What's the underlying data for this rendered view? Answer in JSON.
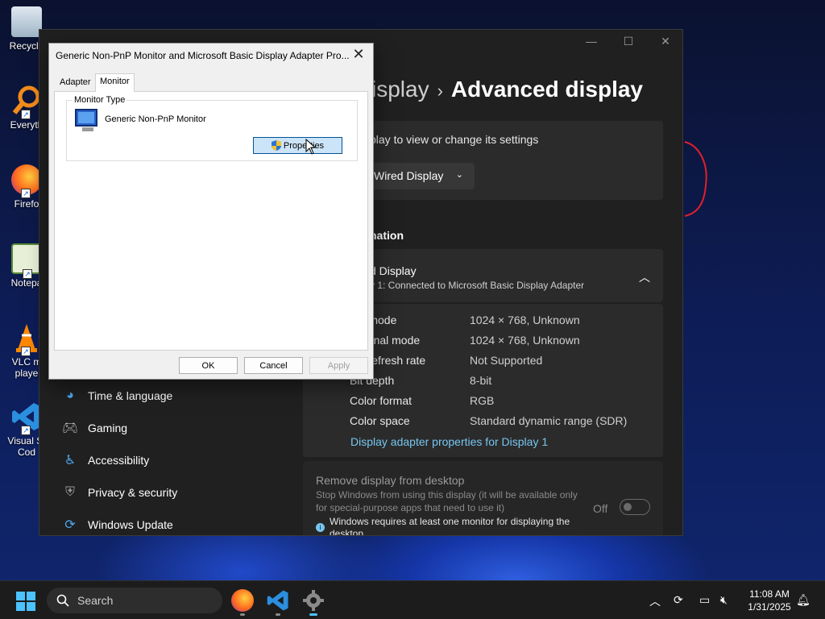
{
  "desktop": {
    "icons": [
      {
        "label": "Recycle",
        "icon": "recycle-bin-icon"
      },
      {
        "label": "Everyth",
        "icon": "everything-search-icon"
      },
      {
        "label": "Firefo",
        "icon": "firefox-icon"
      },
      {
        "label": "Notepa",
        "icon": "notepad-icon"
      },
      {
        "label": "VLC m playe",
        "icon": "vlc-icon"
      },
      {
        "label": "Visual St Cod",
        "icon": "vscode-icon"
      }
    ]
  },
  "settings": {
    "breadcrumb_prev": "isplay",
    "breadcrumb_current": "Advanced display",
    "select_text": "play to view or change its settings",
    "display_dropdown": "Wired Display",
    "section_heading": "nation",
    "info_title": "d Display",
    "info_subtitle": "y 1: Connected to Microsoft Basic Display Adapter",
    "rows": [
      {
        "label": "top mode",
        "value": "1024 × 768, Unknown"
      },
      {
        "label": "e signal mode",
        "value": "1024 × 768, Unknown"
      },
      {
        "label": "ble refresh rate",
        "value": "Not Supported"
      },
      {
        "label": "Bit depth",
        "value": "8-bit"
      },
      {
        "label": "Color format",
        "value": "RGB"
      },
      {
        "label": "Color space",
        "value": "Standard dynamic range (SDR)"
      }
    ],
    "link": "Display adapter properties for Display 1",
    "remove_title": "Remove display from desktop",
    "remove_desc": "Stop Windows from using this display (it will be available only for special-purpose apps that need to use it)",
    "toggle_label": "Off",
    "warning": "Windows requires at least one monitor for displaying the desktop",
    "nav": [
      {
        "label": "Time & language",
        "icon": "globe-clock-icon"
      },
      {
        "label": "Gaming",
        "icon": "gamepad-icon"
      },
      {
        "label": "Accessibility",
        "icon": "accessibility-icon"
      },
      {
        "label": "Privacy & security",
        "icon": "shield-icon"
      },
      {
        "label": "Windows Update",
        "icon": "update-icon"
      }
    ]
  },
  "dialog": {
    "title": "Generic Non-PnP Monitor and Microsoft Basic Display Adapter Pro...",
    "tabs": [
      "Adapter",
      "Monitor"
    ],
    "group_label": "Monitor Type",
    "monitor_name": "Generic Non-PnP Monitor",
    "properties_button": "Properties",
    "ok": "OK",
    "cancel": "Cancel",
    "apply": "Apply"
  },
  "taskbar": {
    "search_placeholder": "Search",
    "time": "11:08 AM",
    "date": "1/31/2025"
  }
}
